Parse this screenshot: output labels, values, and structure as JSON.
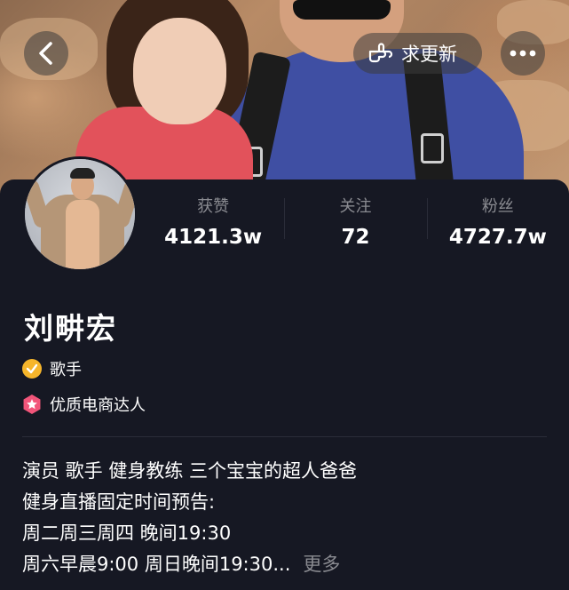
{
  "topbar": {
    "back_icon": "chevron-left-icon",
    "update_icon": "hand-pointing-icon",
    "update_label": "求更新",
    "more_icon": "ellipsis-icon"
  },
  "profile": {
    "name": "刘畊宏",
    "stats": [
      {
        "label": "获赞",
        "value": "4121.3w"
      },
      {
        "label": "关注",
        "value": "72"
      },
      {
        "label": "粉丝",
        "value": "4727.7w"
      }
    ],
    "verification": {
      "icon": "verified-check-icon",
      "label": "歌手",
      "color": "#F6B52B"
    },
    "merchant_badge": {
      "icon": "star-badge-icon",
      "label": "优质电商达人",
      "color": "#F2557A"
    },
    "bio_lines": [
      "演员 歌手 健身教练 三个宝宝的超人爸爸",
      "健身直播固定时间预告:",
      "周二周三周四 晚间19:30",
      "周六早晨9:00 周日晚间19:30..."
    ],
    "more_label": "更多"
  },
  "colors": {
    "background": "#161823",
    "muted_text": "#8A8B91"
  }
}
